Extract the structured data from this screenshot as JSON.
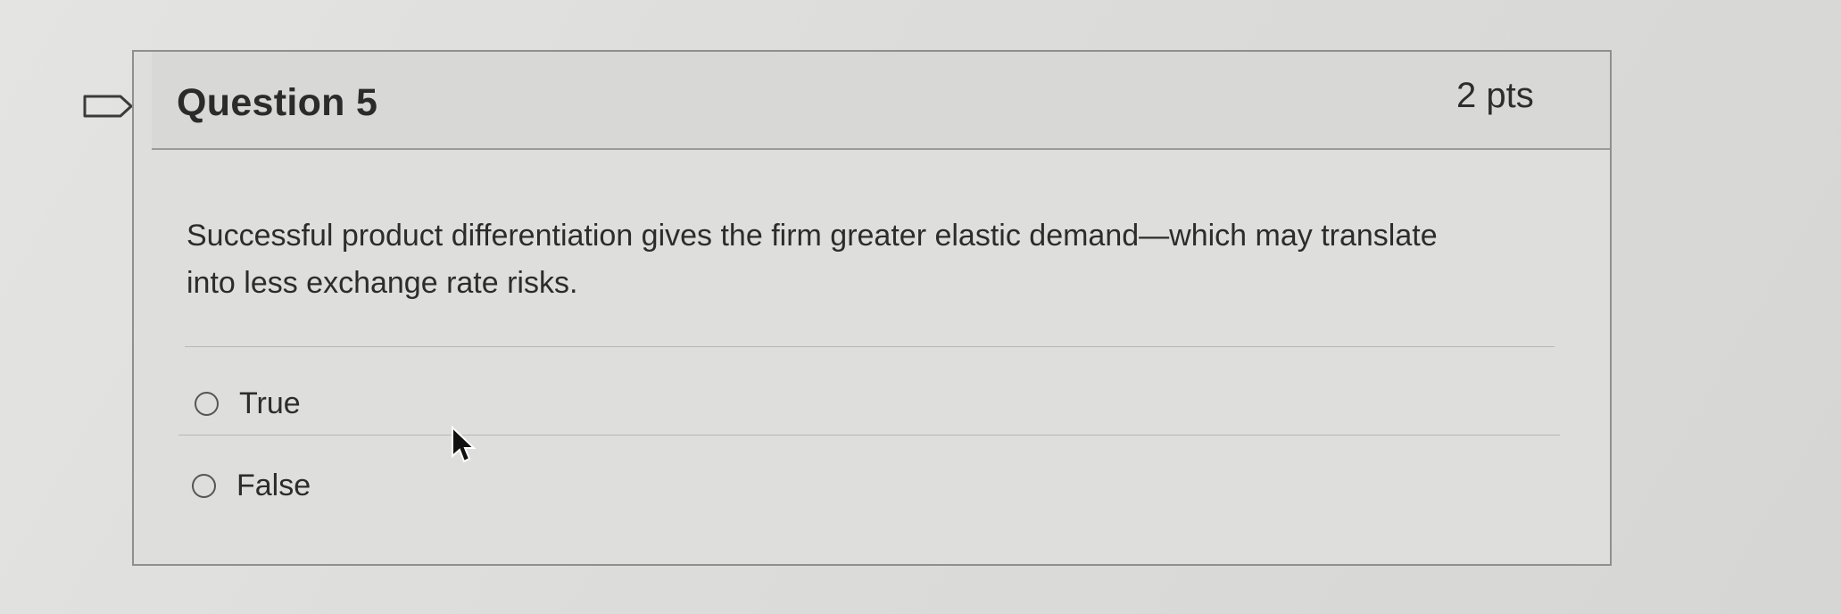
{
  "question": {
    "title": "Question 5",
    "points": "2 pts",
    "text": "Successful product differentiation gives the firm greater elastic demand—which may translate into less exchange rate risks."
  },
  "answers": [
    {
      "label": "True",
      "selected": false
    },
    {
      "label": "False",
      "selected": false
    }
  ],
  "icons": {
    "flag": "flag-icon",
    "radio": "radio-button",
    "cursor": "mouse-pointer-icon"
  }
}
